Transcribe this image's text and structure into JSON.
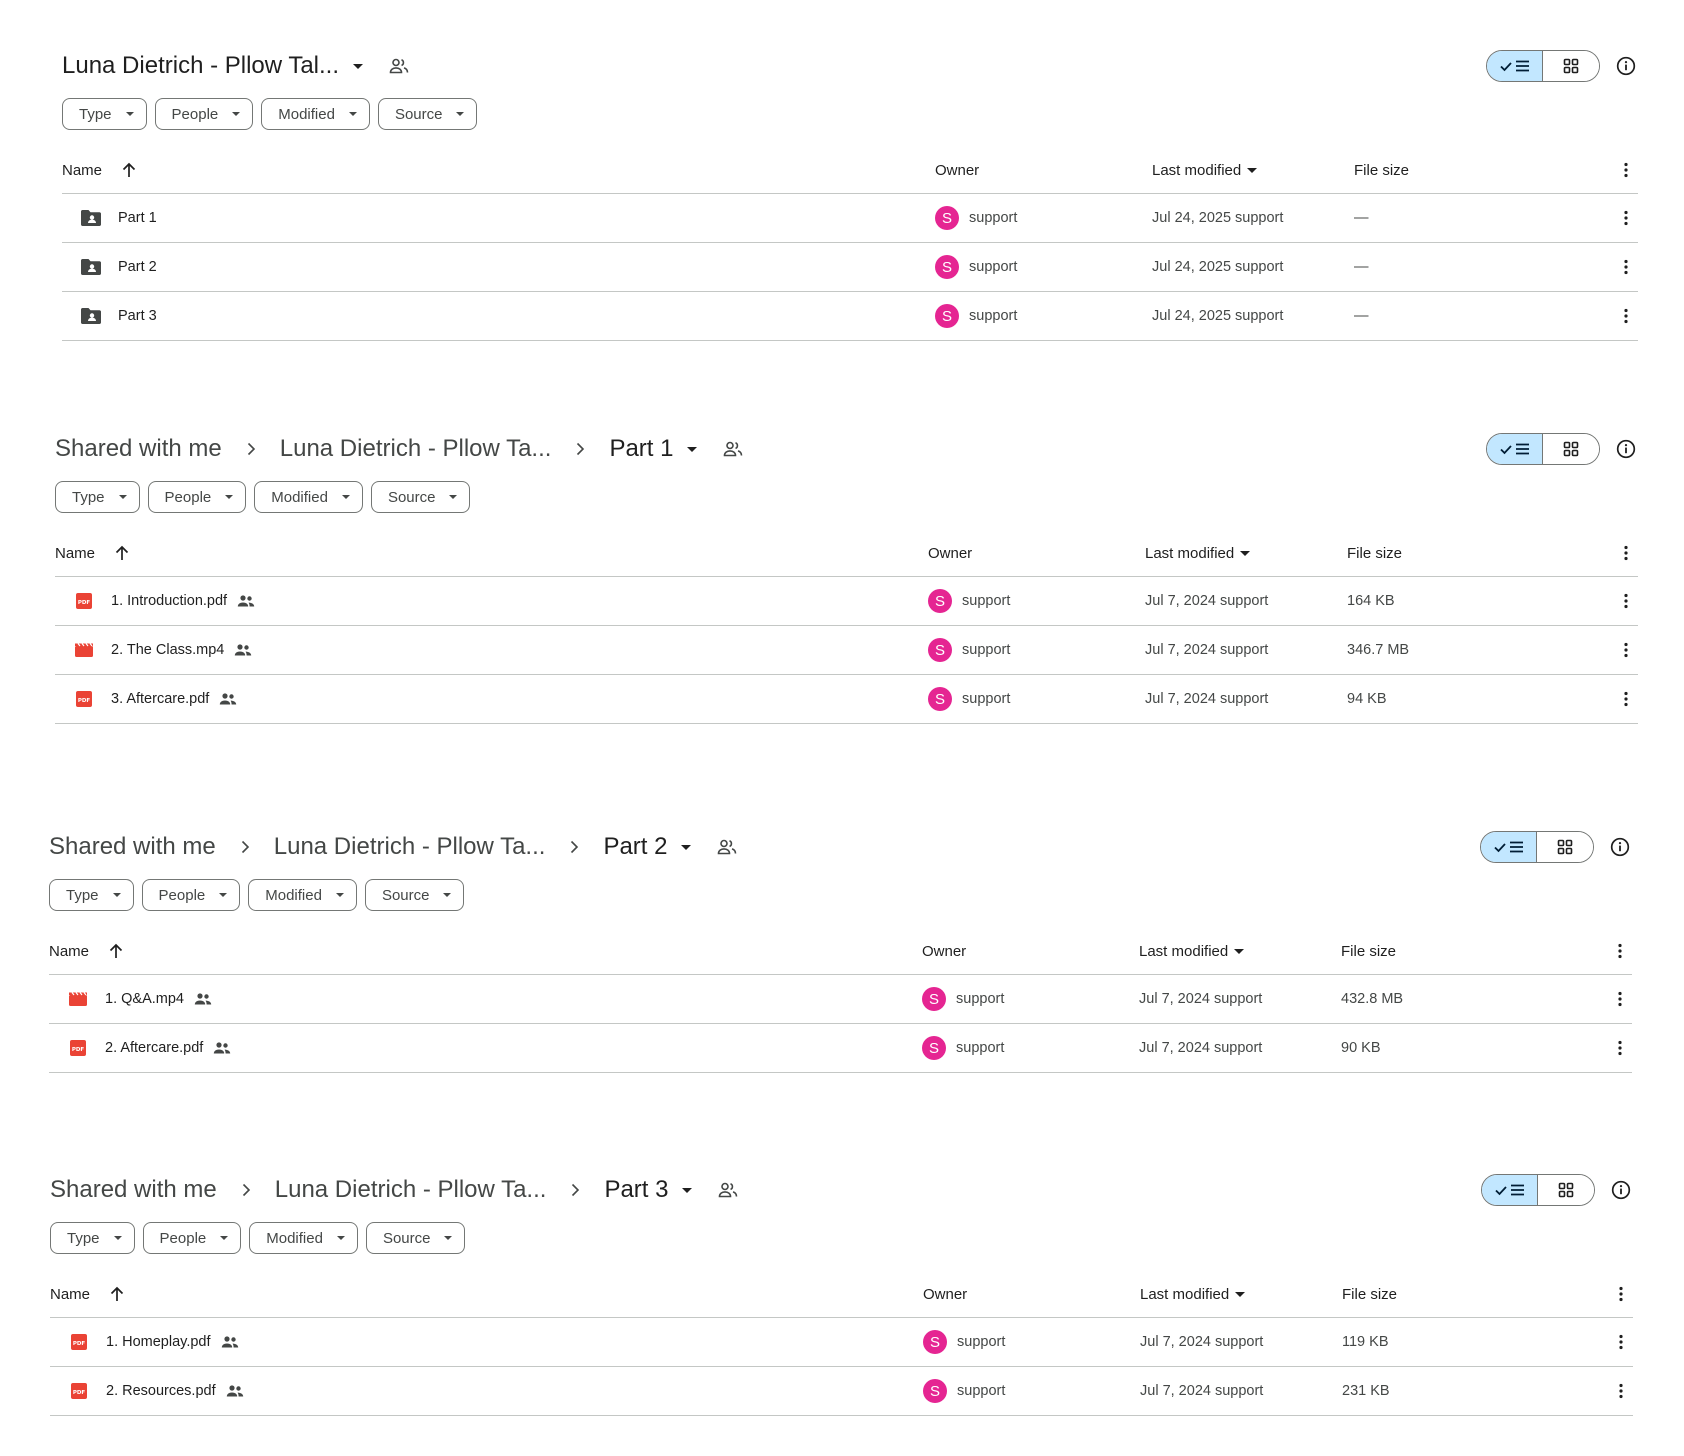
{
  "filters": [
    "Type",
    "People",
    "Modified",
    "Source"
  ],
  "columns": {
    "name": "Name",
    "owner": "Owner",
    "last_modified": "Last modified",
    "file_size": "File size"
  },
  "panels": [
    {
      "breadcrumb": [
        "Luna Dietrich - Pllow Tal..."
      ],
      "rows": [
        {
          "icon": "shared-folder-icon",
          "name": "Part 1",
          "owner": "support",
          "owner_initial": "S",
          "modified": "Jul 24, 2025 support",
          "size": "—",
          "shared": false
        },
        {
          "icon": "shared-folder-icon",
          "name": "Part 2",
          "owner": "support",
          "owner_initial": "S",
          "modified": "Jul 24, 2025 support",
          "size": "—",
          "shared": false
        },
        {
          "icon": "shared-folder-icon",
          "name": "Part 3",
          "owner": "support",
          "owner_initial": "S",
          "modified": "Jul 24, 2025 support",
          "size": "—",
          "shared": false
        }
      ]
    },
    {
      "breadcrumb": [
        "Shared with me",
        "Luna Dietrich - Pllow Ta...",
        "Part 1"
      ],
      "rows": [
        {
          "icon": "pdf-icon",
          "name": "1. Introduction.pdf",
          "owner": "support",
          "owner_initial": "S",
          "modified": "Jul 7, 2024 support",
          "size": "164 KB",
          "shared": true
        },
        {
          "icon": "video-icon",
          "name": "2. The Class.mp4",
          "owner": "support",
          "owner_initial": "S",
          "modified": "Jul 7, 2024 support",
          "size": "346.7 MB",
          "shared": true
        },
        {
          "icon": "pdf-icon",
          "name": "3. Aftercare.pdf",
          "owner": "support",
          "owner_initial": "S",
          "modified": "Jul 7, 2024 support",
          "size": "94 KB",
          "shared": true
        }
      ]
    },
    {
      "breadcrumb": [
        "Shared with me",
        "Luna Dietrich - Pllow Ta...",
        "Part 2"
      ],
      "rows": [
        {
          "icon": "video-icon",
          "name": "1. Q&A.mp4",
          "owner": "support",
          "owner_initial": "S",
          "modified": "Jul 7, 2024 support",
          "size": "432.8 MB",
          "shared": true
        },
        {
          "icon": "pdf-icon",
          "name": "2. Aftercare.pdf",
          "owner": "support",
          "owner_initial": "S",
          "modified": "Jul 7, 2024 support",
          "size": "90 KB",
          "shared": true
        }
      ]
    },
    {
      "breadcrumb": [
        "Shared with me",
        "Luna Dietrich - Pllow Ta...",
        "Part 3"
      ],
      "rows": [
        {
          "icon": "pdf-icon",
          "name": "1. Homeplay.pdf",
          "owner": "support",
          "owner_initial": "S",
          "modified": "Jul 7, 2024 support",
          "size": "119 KB",
          "shared": true
        },
        {
          "icon": "pdf-icon",
          "name": "2. Resources.pdf",
          "owner": "support",
          "owner_initial": "S",
          "modified": "Jul 7, 2024 support",
          "size": "231 KB",
          "shared": true
        }
      ]
    }
  ],
  "colors": {
    "avatar": "#e52592",
    "pdf": "#ea4335",
    "video": "#ea4335",
    "folder": "#444746",
    "toggle_active": "#c2e7ff"
  }
}
